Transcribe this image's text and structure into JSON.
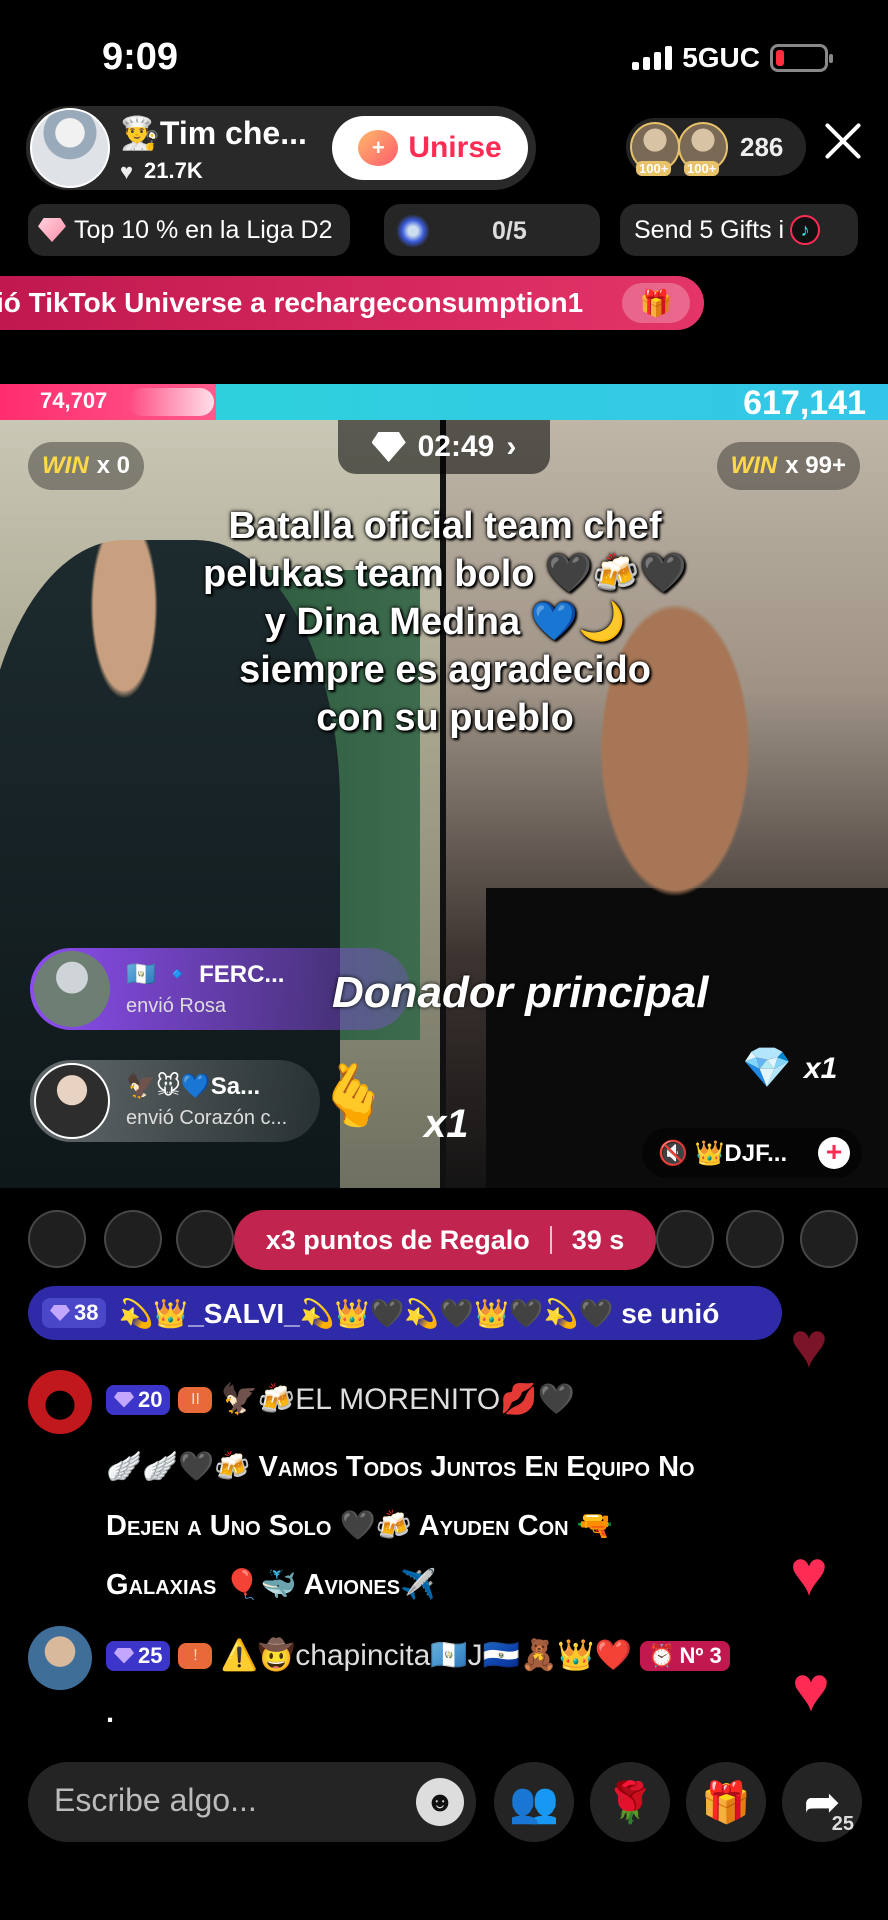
{
  "status": {
    "time": "9:09",
    "network": "5GUC"
  },
  "host": {
    "name": "Tim che...",
    "likes": "21.7K",
    "join_label": "Unirse"
  },
  "viewers": {
    "badge1": "100+",
    "badge2": "100+",
    "count": "286"
  },
  "chips": {
    "league": "Top 10 % en la Liga D2",
    "goal": "0/5",
    "gifts": "Send 5 Gifts i"
  },
  "banner": {
    "text": "ió TikTok Universe a rechargeconsumption1"
  },
  "battle": {
    "left_score": "74,707",
    "right_score": "617,141"
  },
  "video": {
    "win_left_label": "WIN",
    "win_left_count": "x 0",
    "win_right_label": "WIN",
    "win_right_count": "x 99+",
    "timer": "02:49",
    "caption": [
      "Batalla oficial team chef",
      "pelukas team bolo 🖤🍻🖤",
      "y Dina Medina 💙🌙",
      "siempre es agradecido",
      "con su pueblo"
    ],
    "donor_text": "Donador principal",
    "toast1": {
      "name": "🇬🇹 🔹 FERC...",
      "sub": "envió Rosa"
    },
    "toast2": {
      "name": "🦅🐭💙Sa...",
      "sub": "envió Corazón c..."
    },
    "gift_count_left": "x1",
    "gift_count_right": "x1",
    "mute_label": "🔇 👑DJF..."
  },
  "points": {
    "label": "x3 puntos de Regalo",
    "time": "39 s"
  },
  "join_notice": {
    "level": "38",
    "text": "💫👑_SALVI_💫👑🖤💫🖤👑🖤💫🖤 se unió"
  },
  "comments": [
    {
      "level": "20",
      "name": "🦅🍻EL MORENITO💋🖤",
      "lines": [
        "🪽🪽🖤🍻 Vamos Todos Juntos En Equipo No",
        "Dejen a Uno Solo 🖤🍻 Ayuden Con 🔫",
        "Galaxias 🎈🐳 Aviones✈️"
      ]
    },
    {
      "level": "25",
      "name": "⚠️🤠chapincita🇬🇹J🇸🇻🧸👑❤️",
      "rank": "Nº 3",
      "lines": [
        "."
      ]
    }
  ],
  "input": {
    "placeholder": "Escribe algo..."
  },
  "share": {
    "count": "25"
  },
  "colors": {
    "accent": "#fe2c55",
    "battle_left": "#ff2d6f",
    "battle_right": "#2cd4d9",
    "join_notice": "#2e2aa8"
  }
}
